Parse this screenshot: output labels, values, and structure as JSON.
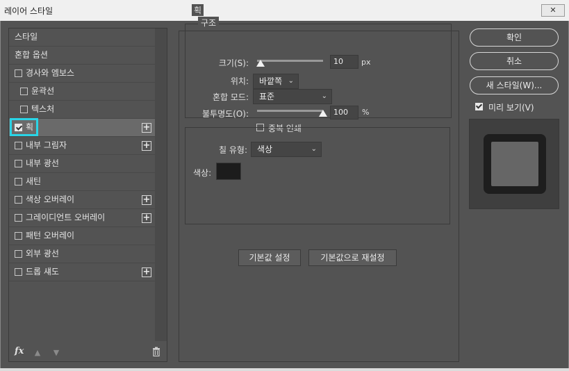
{
  "window": {
    "title": "레이어 스타일",
    "close_label": "✕"
  },
  "left": {
    "items": [
      {
        "label": "스타일",
        "checkbox": false,
        "checked": false,
        "indent": false,
        "plus": false
      },
      {
        "label": "혼합 옵션",
        "checkbox": false,
        "checked": false,
        "indent": false,
        "plus": false
      },
      {
        "label": "경사와 엠보스",
        "checkbox": true,
        "checked": false,
        "indent": false,
        "plus": false
      },
      {
        "label": "윤곽선",
        "checkbox": true,
        "checked": false,
        "indent": true,
        "plus": false
      },
      {
        "label": "텍스처",
        "checkbox": true,
        "checked": false,
        "indent": true,
        "plus": false
      },
      {
        "label": "획",
        "checkbox": true,
        "checked": true,
        "indent": false,
        "plus": true,
        "selected": true
      },
      {
        "label": "내부 그림자",
        "checkbox": true,
        "checked": false,
        "indent": false,
        "plus": true
      },
      {
        "label": "내부 광선",
        "checkbox": true,
        "checked": false,
        "indent": false,
        "plus": false
      },
      {
        "label": "새틴",
        "checkbox": true,
        "checked": false,
        "indent": false,
        "plus": false
      },
      {
        "label": "색상 오버레이",
        "checkbox": true,
        "checked": false,
        "indent": false,
        "plus": true
      },
      {
        "label": "그레이디언트 오버레이",
        "checkbox": true,
        "checked": false,
        "indent": false,
        "plus": true
      },
      {
        "label": "패턴 오버레이",
        "checkbox": true,
        "checked": false,
        "indent": false,
        "plus": false
      },
      {
        "label": "외부 광선",
        "checkbox": true,
        "checked": false,
        "indent": false,
        "plus": false
      },
      {
        "label": "드롭 섀도",
        "checkbox": true,
        "checked": false,
        "indent": false,
        "plus": true
      }
    ],
    "footer": {
      "fx_label": "fx",
      "up_icon": "arrow-up-icon",
      "down_icon": "arrow-down-icon",
      "trash_icon": "trash-icon"
    }
  },
  "stroke": {
    "section_title": "획",
    "structure": {
      "title": "구조",
      "size_label": "크기(S):",
      "size_value": "10",
      "size_unit": "px",
      "size_slider_fraction": 0.05,
      "position_label": "위치:",
      "position_value": "바깥쪽",
      "blend_label": "혼합 모드:",
      "blend_value": "표준",
      "opacity_label": "불투명도(O):",
      "opacity_value": "100",
      "opacity_unit": "%",
      "opacity_slider_fraction": 1.0,
      "overprint_label": "중복 인쇄",
      "overprint_checked": false
    },
    "fill": {
      "type_label": "칠 유형:",
      "type_value": "색상",
      "color_label": "색상:",
      "color_hex": "#1c1c1c"
    },
    "default_button": "기본값 설정",
    "reset_button": "기본값으로 재설정"
  },
  "right": {
    "ok_button": "확인",
    "cancel_button": "취소",
    "new_style_button": "새 스타일(W)...",
    "preview_label": "미리 보기(V)",
    "preview_checked": true
  },
  "colors": {
    "panel_bg": "#535353",
    "accent_focus": "#2ad4e6"
  }
}
